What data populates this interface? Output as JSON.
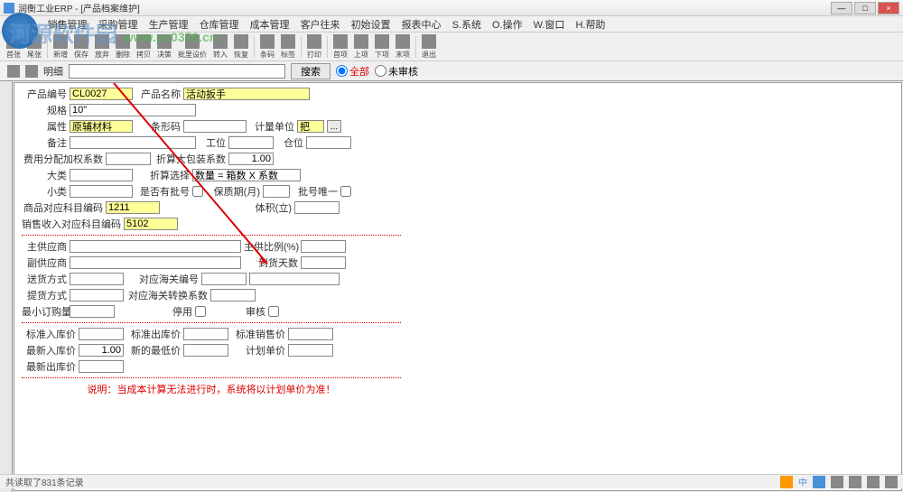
{
  "window": {
    "title": "润衡工业ERP - [产品档案维护]"
  },
  "menu": {
    "items": [
      "F.文件",
      "销售管理",
      "采购管理",
      "生产管理",
      "仓库管理",
      "成本管理",
      "客户往来",
      "初始设置",
      "报表中心",
      "S.系统",
      "O.操作",
      "W.窗口",
      "H.帮助"
    ]
  },
  "toolbar": {
    "items": [
      "首张",
      "尾张",
      "新增",
      "保存",
      "放弃",
      "删除",
      "拷贝",
      "决策",
      "批里设价",
      "转入",
      "恢复",
      "条码",
      "标签",
      "打印",
      "首项",
      "上项",
      "下项",
      "末项",
      "退出"
    ]
  },
  "watermark": {
    "text1": "河源软件园",
    "url": "www.pc0359.cn"
  },
  "search": {
    "label": "明细",
    "btn": "搜索",
    "opt_all": "全部",
    "opt_unaudit": "未审核"
  },
  "form": {
    "product_code_lbl": "产品编号",
    "product_code_val": "CL0027",
    "product_name_lbl": "产品名称",
    "product_name_val": "活动扳手",
    "spec_lbl": "规格",
    "spec_val": "10\"",
    "attr_lbl": "属性",
    "attr_val": "原辅材料",
    "barcode_lbl": "条形码",
    "unit_lbl": "计量单位",
    "unit_val": "把",
    "note_lbl": "备注",
    "process_lbl": "工位",
    "bin_lbl": "仓位",
    "cost_coef_lbl": "费用分配加权系数",
    "pack_coef_lbl": "折算大包装系数",
    "pack_coef_val": "1.00",
    "method_lbl": "折算选择",
    "method_val": "数量 = 箱数 X 系数",
    "cat1_lbl": "大类",
    "cat2_lbl": "小类",
    "batch_check_lbl": "是否有批号",
    "warranty_lbl": "保质期(月)",
    "batch_unique_lbl": "批号唯一",
    "inv_subj_lbl": "商品对应科目编码",
    "inv_subj_val": "1211",
    "volume_lbl": "体积(立)",
    "sales_subj_lbl": "销售收入对应科目编码",
    "sales_subj_val": "5102",
    "main_supplier_lbl": "主供应商",
    "main_ratio_lbl": "主供比例(%)",
    "sub_supplier_lbl": "副供应商",
    "arrive_days_lbl": "到货天数",
    "deliver_lbl": "送货方式",
    "customs_lbl": "对应海关编号",
    "purchase_lbl": "提货方式",
    "customs_coef_lbl": "对应海关转换系数",
    "min_order_lbl": "最小订购量",
    "disable_lbl": "停用",
    "audit_lbl": "审核",
    "std_in_lbl": "标准入库价",
    "std_out_lbl": "标准出库价",
    "std_sell_lbl": "标准销售价",
    "latest_in_lbl": "最新入库价",
    "latest_in_val": "1.00",
    "new_low_lbl": "新的最低价",
    "plan_price_lbl": "计划单价",
    "latest_out_lbl": "最新出库价",
    "footer_note": "说明：当成本计算无法进行时，系统将以计划单价为准！"
  },
  "status": {
    "text": "共读取了831条记录"
  },
  "tray": {
    "ime": "中",
    "time_indicator": "●"
  }
}
